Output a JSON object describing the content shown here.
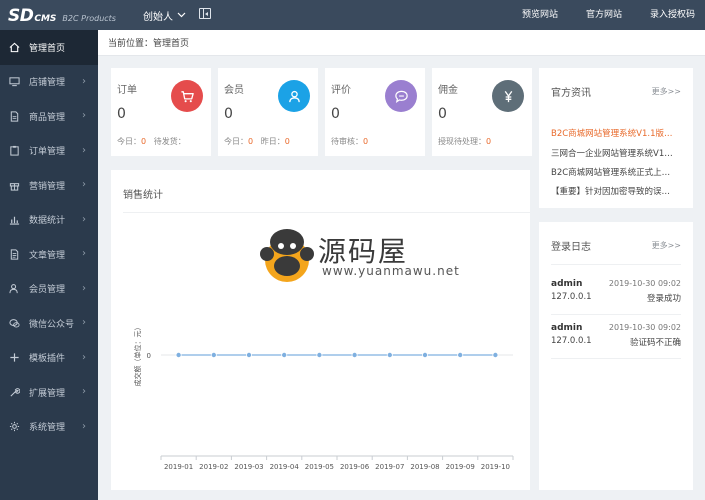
{
  "header": {
    "logo_main": "SD",
    "logo_sub": "CMS",
    "logo_tag": "B2C Products",
    "user": "创始人",
    "links": [
      "预览网站",
      "官方网站",
      "录入授权码"
    ]
  },
  "sidebar": {
    "items": [
      {
        "label": "管理首页",
        "icon": "home-icon",
        "active": true,
        "chevron": false
      },
      {
        "label": "店铺管理",
        "icon": "monitor-icon",
        "active": false,
        "chevron": true
      },
      {
        "label": "商品管理",
        "icon": "file-icon",
        "active": false,
        "chevron": true
      },
      {
        "label": "订单管理",
        "icon": "clipboard-icon",
        "active": false,
        "chevron": true
      },
      {
        "label": "营销管理",
        "icon": "gift-icon",
        "active": false,
        "chevron": true
      },
      {
        "label": "数据统计",
        "icon": "bar-chart-icon",
        "active": false,
        "chevron": true
      },
      {
        "label": "文章管理",
        "icon": "document-icon",
        "active": false,
        "chevron": true
      },
      {
        "label": "会员管理",
        "icon": "users-icon",
        "active": false,
        "chevron": true
      },
      {
        "label": "微信公众号",
        "icon": "wechat-icon",
        "active": false,
        "chevron": true
      },
      {
        "label": "模板插件",
        "icon": "plus-icon",
        "active": false,
        "chevron": true
      },
      {
        "label": "扩展管理",
        "icon": "wrench-icon",
        "active": false,
        "chevron": true
      },
      {
        "label": "系统管理",
        "icon": "gear-icon",
        "active": false,
        "chevron": true
      }
    ]
  },
  "breadcrumb": "当前位置：管理首页",
  "stats": [
    {
      "title": "订单",
      "value": "0",
      "color": "#e54c4c",
      "icon": "cart-icon",
      "foot_a_label": "今日：",
      "foot_a_value": "0",
      "foot_b_label": "待发货：",
      "foot_b_value": ""
    },
    {
      "title": "会员",
      "value": "0",
      "color": "#1ba2e6",
      "icon": "user-icon",
      "foot_a_label": "今日：",
      "foot_a_value": "0",
      "foot_b_label": "昨日：",
      "foot_b_value": "0"
    },
    {
      "title": "评价",
      "value": "0",
      "color": "#9a7fd0",
      "icon": "chat-icon",
      "foot_a_label": "待审核：",
      "foot_a_value": "0",
      "foot_b_label": "",
      "foot_b_value": ""
    },
    {
      "title": "佣金",
      "value": "0",
      "color": "#5e6e78",
      "icon": "yen-icon",
      "foot_a_label": "授现待处理：",
      "foot_a_value": "0",
      "foot_b_label": "",
      "foot_b_value": ""
    }
  ],
  "sales": {
    "title": "销售统计"
  },
  "chart_data": {
    "type": "line",
    "title": "",
    "xlabel": "",
    "ylabel": "成交额（单位：元）",
    "categories": [
      "2019-01",
      "2019-02",
      "2019-03",
      "2019-04",
      "2019-05",
      "2019-06",
      "2019-07",
      "2019-08",
      "2019-09",
      "2019-10"
    ],
    "series": [
      {
        "values": [
          0,
          0,
          0,
          0,
          0,
          0,
          0,
          0,
          0,
          0
        ],
        "color": "#7fb0e0"
      }
    ],
    "yticks": [
      "0"
    ],
    "grid": false,
    "legend": "none"
  },
  "watermark": {
    "text": "源码屋",
    "url": "www.yuanmawu.net"
  },
  "news": {
    "title": "官方资讯",
    "more": "更多>>",
    "items": [
      {
        "text": "B2C商城网站管理系统V1.1版…",
        "highlight": true
      },
      {
        "text": "三网合一企业网站管理系统V1…",
        "highlight": false
      },
      {
        "text": "B2C商城网站管理系统正式上…",
        "highlight": false
      },
      {
        "text": "【重要】针对因加密导致的误…",
        "highlight": false
      }
    ]
  },
  "login_log": {
    "title": "登录日志",
    "more": "更多>>",
    "entries": [
      {
        "user": "admin",
        "time": "2019-10-30 09:02",
        "ip": "127.0.0.1",
        "status": "登录成功"
      },
      {
        "user": "admin",
        "time": "2019-10-30 09:02",
        "ip": "127.0.0.1",
        "status": "验证码不正确"
      }
    ]
  }
}
